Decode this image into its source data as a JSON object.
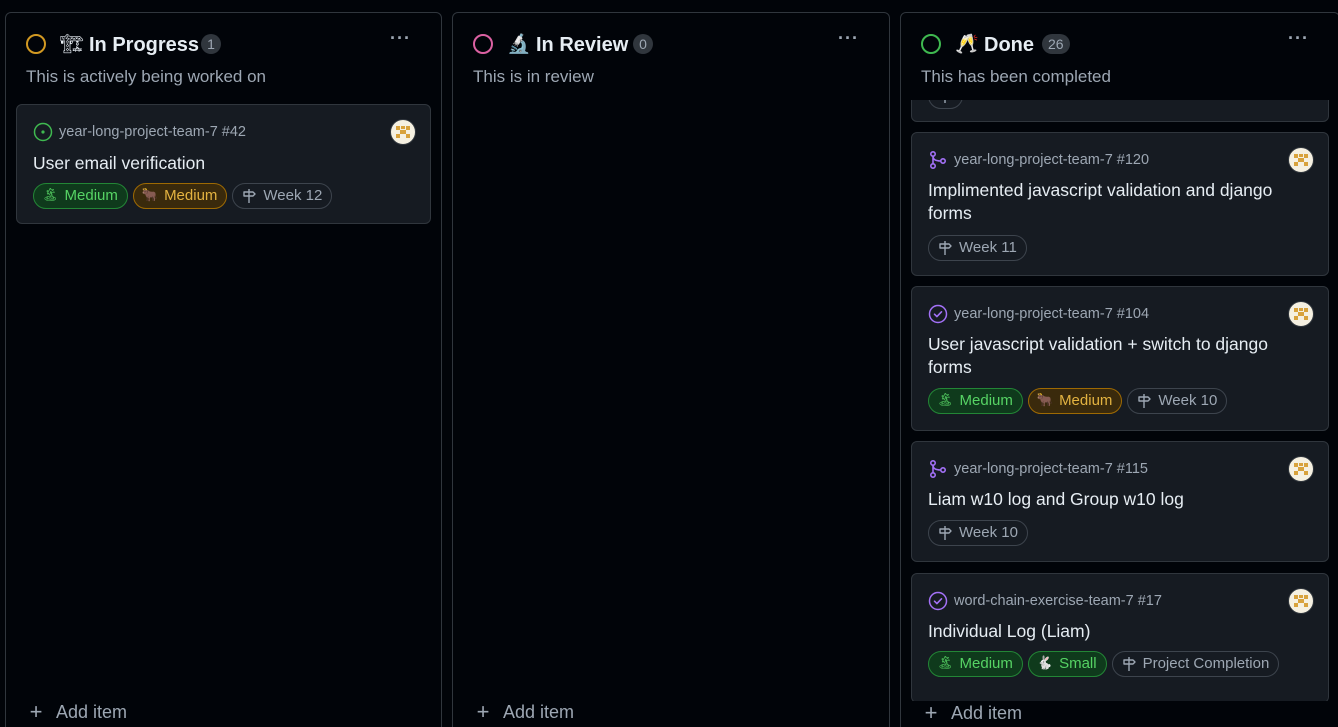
{
  "columns": [
    {
      "title": "In Progress",
      "emoji": "🏗",
      "count": "1",
      "description": "This is actively being worked on",
      "status_color": "#d29922",
      "menu": "···",
      "add_item": "Add item",
      "cards": [
        {
          "repo": "year-long-project-team-7 #42",
          "status": "open-issue",
          "title": "User email verification",
          "labels": [
            {
              "emoji": "🏝",
              "text": "Medium",
              "style": "green"
            },
            {
              "emoji": "🐂",
              "text": "Medium",
              "style": "orange"
            },
            {
              "emoji": "",
              "text": "Week 12",
              "style": "gray"
            }
          ]
        }
      ]
    },
    {
      "title": "In Review",
      "emoji": "🔬",
      "count": "0",
      "description": "This is in review",
      "status_color": "#db61a2",
      "menu": "···",
      "add_item": "Add item",
      "cards": []
    },
    {
      "title": "Done",
      "emoji": "🥂",
      "count": "26",
      "description": "This has been completed",
      "status_color": "#3fb950",
      "menu": "···",
      "add_item": "Add item",
      "cards": [
        {
          "repo": "year-long-project-team-7 #120",
          "status": "merged-pr",
          "title": "Implimented javascript validation and django forms",
          "labels": [
            {
              "emoji": "",
              "text": "Week 11",
              "style": "gray"
            }
          ]
        },
        {
          "repo": "year-long-project-team-7 #104",
          "status": "closed-issue",
          "title": "User javascript validation + switch to django forms",
          "labels": [
            {
              "emoji": "🏝",
              "text": "Medium",
              "style": "green"
            },
            {
              "emoji": "🐂",
              "text": "Medium",
              "style": "orange"
            },
            {
              "emoji": "",
              "text": "Week 10",
              "style": "gray"
            }
          ]
        },
        {
          "repo": "year-long-project-team-7 #115",
          "status": "merged-pr",
          "title": "Liam w10 log and Group w10 log",
          "labels": [
            {
              "emoji": "",
              "text": "Week 10",
              "style": "gray"
            }
          ]
        },
        {
          "repo": "word-chain-exercise-team-7 #17",
          "status": "closed-issue",
          "title": "Individual Log (Liam)",
          "labels": [
            {
              "emoji": "🏝",
              "text": "Medium",
              "style": "green"
            },
            {
              "emoji": "🐇",
              "text": "Small",
              "style": "green"
            },
            {
              "emoji": "",
              "text": "Project Completion",
              "style": "gray"
            }
          ]
        }
      ]
    }
  ]
}
